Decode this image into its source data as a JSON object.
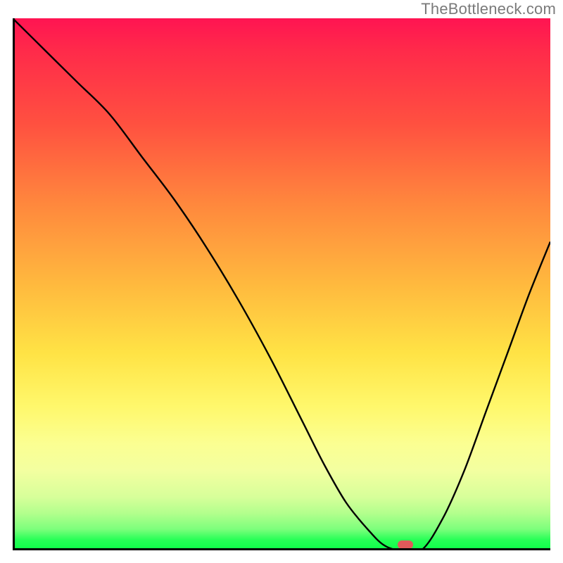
{
  "watermark": "TheBottleneck.com",
  "colors": {
    "axis": "#000000",
    "curve": "#000000",
    "marker": "#e05a5a",
    "gradient_top": "#ff1452",
    "gradient_mid": "#ffe345",
    "gradient_bottom": "#0aff47"
  },
  "chart_data": {
    "type": "line",
    "title": "",
    "xlabel": "",
    "ylabel": "",
    "xlim": [
      0,
      100
    ],
    "ylim": [
      0,
      100
    ],
    "grid": false,
    "legend": false,
    "series": [
      {
        "name": "bottleneck-curve",
        "x": [
          0,
          6,
          12,
          18,
          24,
          30,
          36,
          42,
          48,
          54,
          58,
          62,
          66,
          69,
          72,
          76,
          80,
          84,
          88,
          92,
          96,
          100
        ],
        "y": [
          100,
          94,
          88,
          82,
          74,
          66,
          57,
          47,
          36,
          24,
          16,
          9,
          4,
          1,
          0,
          0,
          6,
          15,
          26,
          37,
          48,
          58
        ]
      }
    ],
    "annotations": [
      {
        "name": "optimal-marker",
        "x": 73,
        "y": 1
      }
    ],
    "background_gradient": {
      "type": "vertical",
      "stops": [
        {
          "pos": 0.0,
          "color": "#ff1452"
        },
        {
          "pos": 0.35,
          "color": "#ff883d"
        },
        {
          "pos": 0.63,
          "color": "#ffe345"
        },
        {
          "pos": 0.85,
          "color": "#f3ffa0"
        },
        {
          "pos": 0.96,
          "color": "#7dff7c"
        },
        {
          "pos": 1.0,
          "color": "#0aff47"
        }
      ]
    }
  }
}
